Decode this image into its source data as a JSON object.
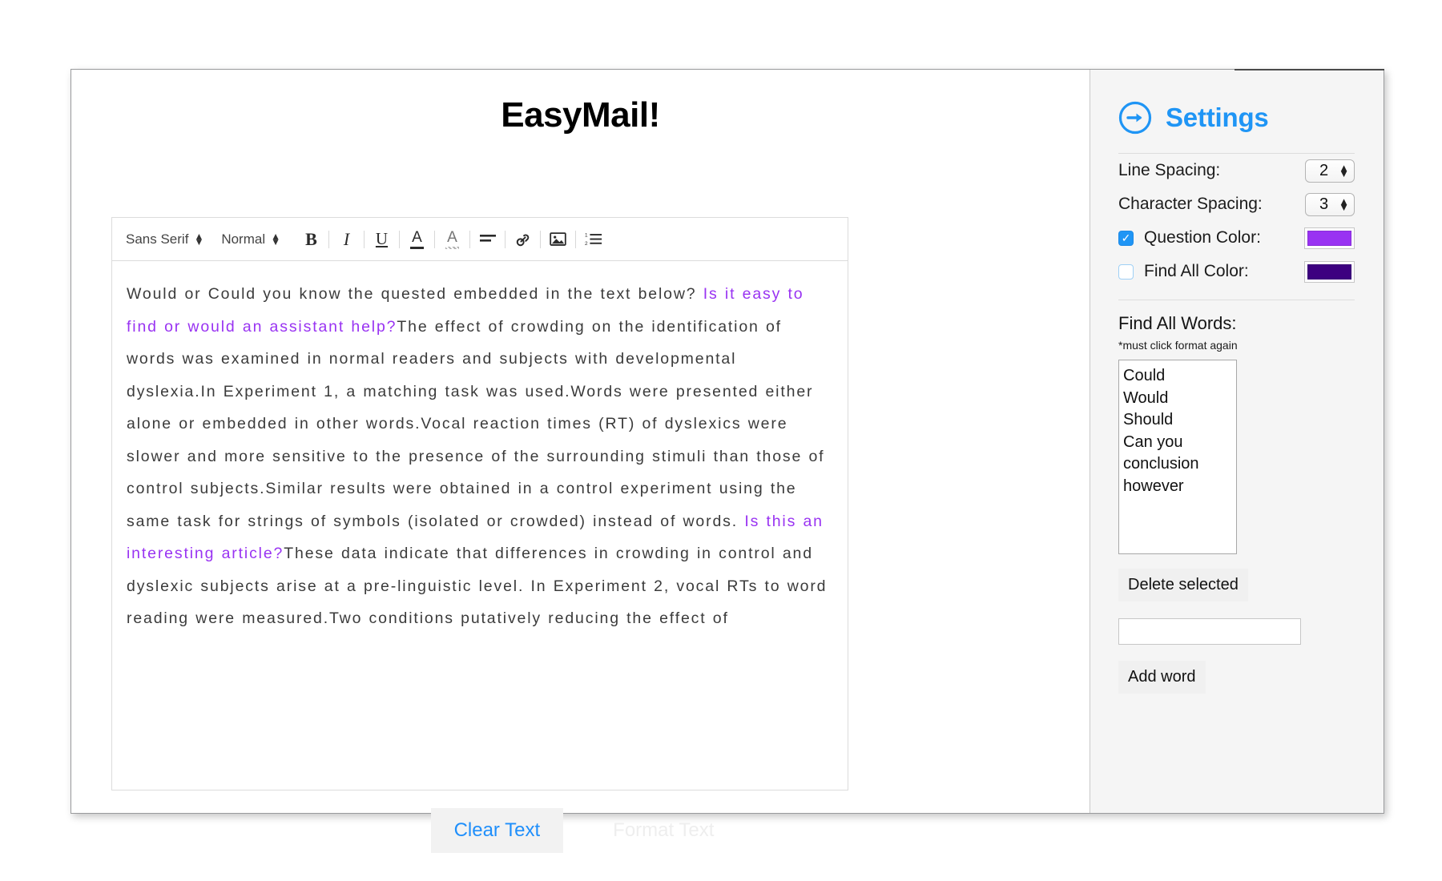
{
  "app": {
    "title": "EasyMail!"
  },
  "toolbar": {
    "font_family": "Sans Serif",
    "font_size": "Normal",
    "bold": "B",
    "italic": "I",
    "underline": "U",
    "text_color": "A",
    "highlight_color": "A",
    "align": "align-left-icon",
    "link": "link-icon",
    "image": "image-icon",
    "list": "ordered-list-icon"
  },
  "document": {
    "paragraphs": [
      {
        "question": "",
        "body": "Would or Could you know the quested embedded in the text below?"
      },
      {
        "question": "Is it easy to find or would an assistant help?",
        "body": "The effect of crowding on the identification of words was examined in normal readers and subjects with developmental dyslexia.In Experiment 1, a matching task was used.Words were presented either alone or embedded in other words.Vocal reaction times (RT) of dyslexics were slower and more sensitive to the presence of the surrounding stimuli than those of control subjects.Similar results were obtained in a control experiment using the same task for strings of symbols (isolated or crowded) instead of words."
      },
      {
        "question": "Is this an interesting article?",
        "body": "These data indicate that differences in crowding in control and dyslexic subjects arise at a pre-linguistic level. In Experiment 2, vocal RTs to word reading were measured.Two conditions putatively reducing the effect of"
      }
    ]
  },
  "actions": {
    "clear_text": "Clear Text",
    "format_text": "Format Text"
  },
  "settings": {
    "title": "Settings",
    "icon": "arrow-right-circle-icon",
    "line_spacing_label": "Line Spacing:",
    "line_spacing_value": "2",
    "character_spacing_label": "Character Spacing:",
    "character_spacing_value": "3",
    "question_color_label": "Question Color:",
    "question_color_checked": true,
    "question_color_value": "#9933f2",
    "find_all_color_label": "Find All Color:",
    "find_all_color_checked": false,
    "find_all_color_value": "#3d0080",
    "find_all_words_label": "Find All Words:",
    "find_all_note": "*must click format again",
    "words": [
      "Could",
      "Would",
      "Should",
      "Can you",
      "conclusion",
      "however"
    ],
    "delete_selected_label": "Delete selected",
    "add_word_input_value": "",
    "add_word_input_placeholder": "",
    "add_word_label": "Add word"
  },
  "colors": {
    "accent_blue": "#1f95f5",
    "question_purple": "#9933f2",
    "find_all_purple": "#3d0080"
  }
}
